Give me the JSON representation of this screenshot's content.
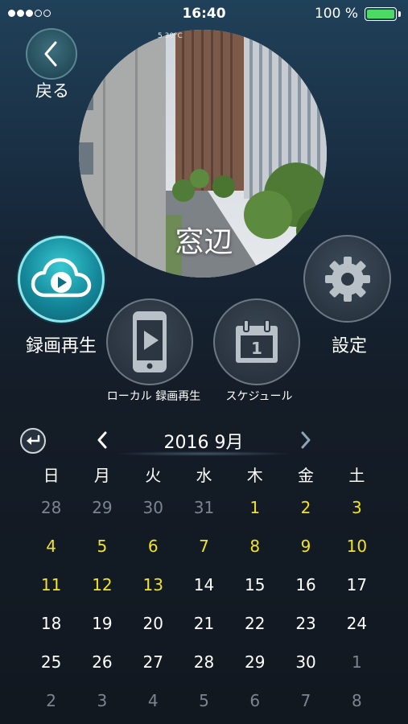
{
  "status_bar": {
    "signal_dots": [
      true,
      true,
      true,
      false,
      false
    ],
    "time": "16:40",
    "battery_percent": "100 %",
    "battery_level": 1.0,
    "battery_color": "#4cd964"
  },
  "nav": {
    "back_icon": "chevron-left-icon",
    "back_label": "戻る"
  },
  "camera": {
    "label": "窓辺",
    "overlay_text": "5 30°C"
  },
  "actions": {
    "playback_label": "録画再生",
    "playback_icon": "cloud-play-icon",
    "settings_label": "設定",
    "settings_icon": "gear-icon",
    "local_label": "ローカル 録画再生",
    "local_icon": "phone-play-icon",
    "schedule_label": "スケジュール",
    "schedule_icon": "calendar-icon",
    "schedule_icon_number": "1"
  },
  "calendar": {
    "month_title": "2016 9月",
    "weekdays": [
      "日",
      "月",
      "火",
      "水",
      "木",
      "金",
      "土"
    ],
    "weeks": [
      [
        {
          "d": "28",
          "t": "other"
        },
        {
          "d": "29",
          "t": "other"
        },
        {
          "d": "30",
          "t": "other"
        },
        {
          "d": "31",
          "t": "other"
        },
        {
          "d": "1",
          "t": "recorded"
        },
        {
          "d": "2",
          "t": "recorded"
        },
        {
          "d": "3",
          "t": "recorded"
        }
      ],
      [
        {
          "d": "4",
          "t": "recorded"
        },
        {
          "d": "5",
          "t": "recorded"
        },
        {
          "d": "6",
          "t": "recorded"
        },
        {
          "d": "7",
          "t": "recorded"
        },
        {
          "d": "8",
          "t": "recorded"
        },
        {
          "d": "9",
          "t": "recorded"
        },
        {
          "d": "10",
          "t": "recorded"
        }
      ],
      [
        {
          "d": "11",
          "t": "recorded"
        },
        {
          "d": "12",
          "t": "recorded"
        },
        {
          "d": "13",
          "t": "recorded"
        },
        {
          "d": "14",
          "t": "normal"
        },
        {
          "d": "15",
          "t": "normal"
        },
        {
          "d": "16",
          "t": "normal"
        },
        {
          "d": "17",
          "t": "normal"
        }
      ],
      [
        {
          "d": "18",
          "t": "normal"
        },
        {
          "d": "19",
          "t": "normal"
        },
        {
          "d": "20",
          "t": "normal"
        },
        {
          "d": "21",
          "t": "normal"
        },
        {
          "d": "22",
          "t": "normal"
        },
        {
          "d": "23",
          "t": "normal"
        },
        {
          "d": "24",
          "t": "normal"
        }
      ],
      [
        {
          "d": "25",
          "t": "normal"
        },
        {
          "d": "26",
          "t": "normal"
        },
        {
          "d": "27",
          "t": "normal"
        },
        {
          "d": "28",
          "t": "normal"
        },
        {
          "d": "29",
          "t": "normal"
        },
        {
          "d": "30",
          "t": "normal"
        },
        {
          "d": "1",
          "t": "other"
        }
      ],
      [
        {
          "d": "2",
          "t": "other"
        },
        {
          "d": "3",
          "t": "other"
        },
        {
          "d": "4",
          "t": "other"
        },
        {
          "d": "5",
          "t": "other"
        },
        {
          "d": "6",
          "t": "other"
        },
        {
          "d": "7",
          "t": "other"
        },
        {
          "d": "8",
          "t": "other"
        }
      ]
    ],
    "colors": {
      "recorded": "#f2e31d",
      "other": "#7b8490",
      "normal": "#ffffff"
    }
  }
}
